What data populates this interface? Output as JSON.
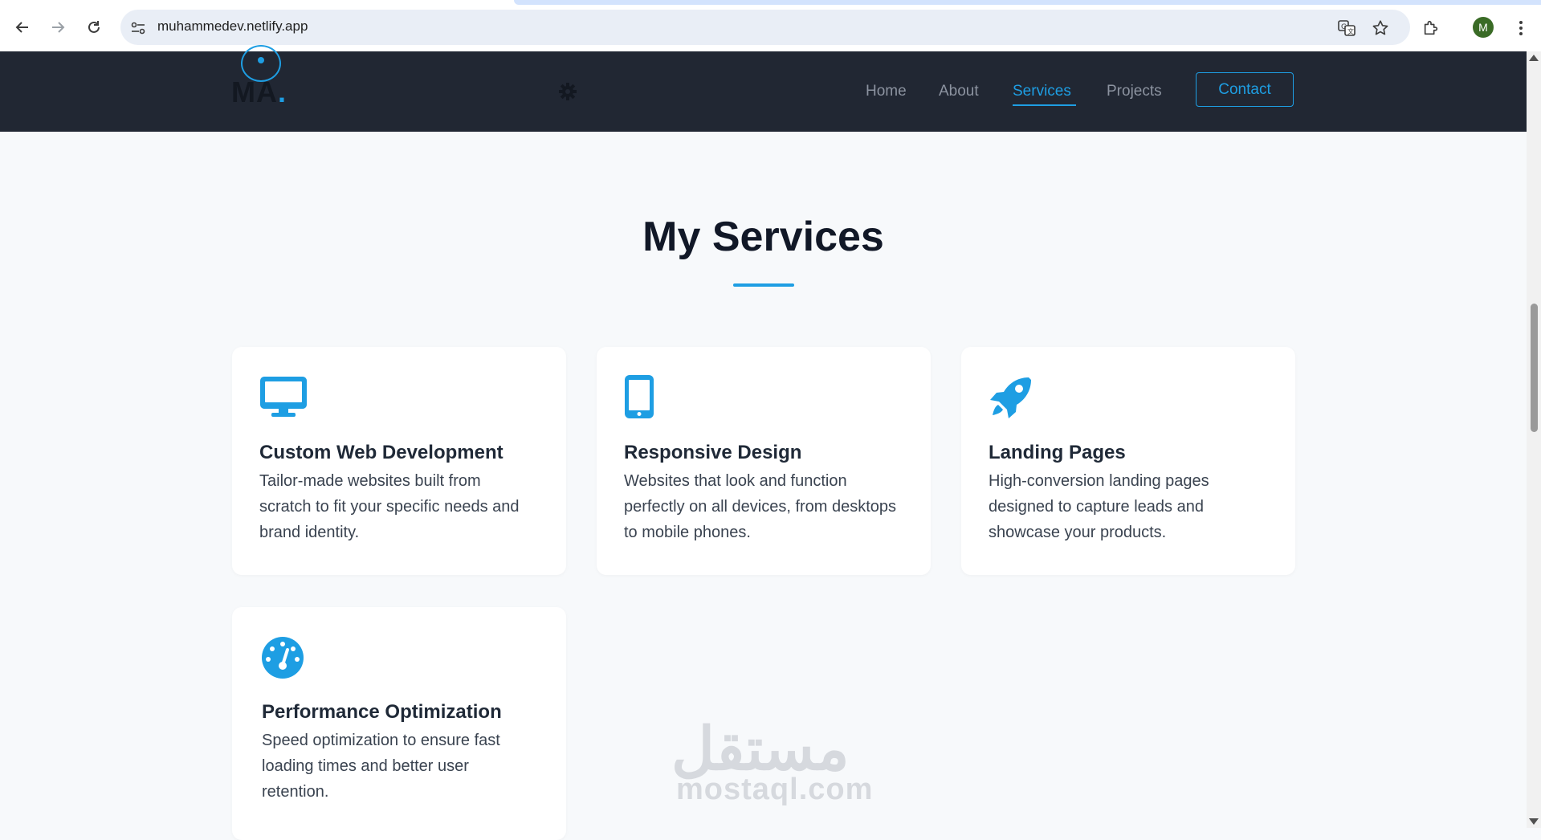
{
  "browser": {
    "url": "muhammedev.netlify.app",
    "profile_initial": "M"
  },
  "site": {
    "logo_text": "MA",
    "nav": {
      "home": "Home",
      "about": "About",
      "services": "Services",
      "projects": "Projects",
      "contact": "Contact"
    }
  },
  "section": {
    "title": "My Services"
  },
  "services": [
    {
      "icon": "desktop-icon",
      "title": "Custom Web Development",
      "description": "Tailor-made websites built from scratch to fit your specific needs and brand identity."
    },
    {
      "icon": "mobile-icon",
      "title": "Responsive Design",
      "description": "Websites that look and function perfectly on all devices, from desktops to mobile phones."
    },
    {
      "icon": "rocket-icon",
      "title": "Landing Pages",
      "description": "High-conversion landing pages designed to capture leads and showcase your products."
    },
    {
      "icon": "gauge-icon",
      "title": "Performance Optimization",
      "description": "Speed optimization to ensure fast loading times and better user retention."
    }
  ],
  "watermark": {
    "arabic": "مستقل",
    "latin": "mostaql.com"
  },
  "colors": {
    "accent": "#1e9ee3",
    "nav_bg": "#212733",
    "page_bg": "#f7f9fb"
  }
}
